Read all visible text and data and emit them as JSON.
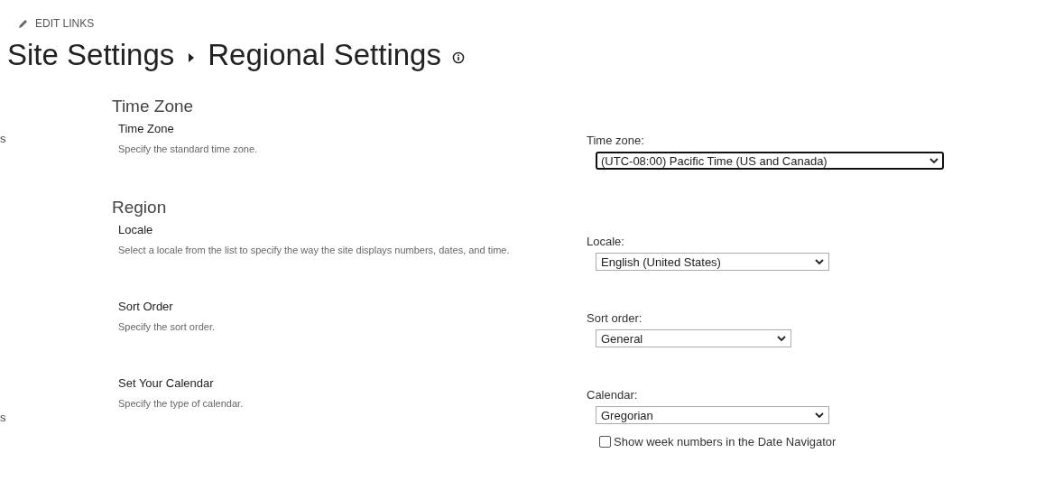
{
  "header": {
    "edit_links": "EDIT LINKS"
  },
  "breadcrumb": [
    {
      "text": "Site Settings"
    },
    {
      "text": "Regional Settings"
    }
  ],
  "left_nav": [
    "s",
    "s"
  ],
  "sections": [
    {
      "heading": "Time Zone",
      "items": [
        {
          "title": "Time Zone",
          "description": "Specify the standard time zone.",
          "field_label": "Time zone:",
          "value": "(UTC-08:00) Pacific Time (US and Canada)",
          "focused": true
        }
      ]
    },
    {
      "heading": "Region",
      "items": [
        {
          "title": "Locale",
          "description": "Select a locale from the list to specify the way the site displays numbers, dates, and time.",
          "field_label": "Locale:",
          "value": "English (United States)",
          "focused": false
        },
        {
          "title": "Sort Order",
          "description": "Specify the sort order.",
          "field_label": "Sort order:",
          "value": "General",
          "focused": false
        },
        {
          "title": "Set Your Calendar",
          "description": "Specify the type of calendar.",
          "field_label": "Calendar:",
          "value": "Gregorian",
          "focused": false,
          "checkbox": {
            "label": "Show week numbers in the Date Navigator",
            "checked": false
          }
        }
      ]
    }
  ]
}
